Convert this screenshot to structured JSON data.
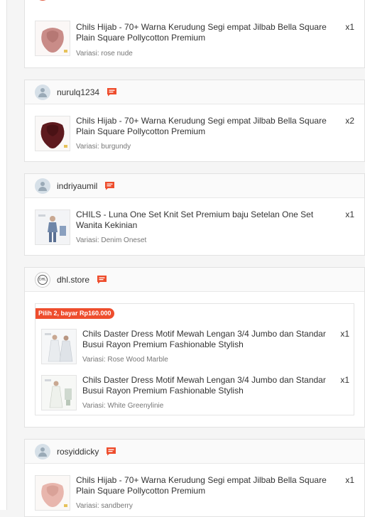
{
  "orders": [
    {
      "items": [
        {
          "name": "Chils Hijab - 70+ Warna Kerudung Segi empat Jilbab Bella Square Plain Square Pollycotton Premium",
          "variation": "Variasi: rose nude",
          "qty": "x1"
        }
      ]
    },
    {
      "username": "nurulq1234",
      "items": [
        {
          "name": "Chils Hijab - 70+ Warna Kerudung Segi empat Jilbab Bella Square Plain Square Pollycotton Premium",
          "variation": "Variasi: burgundy",
          "qty": "x2"
        }
      ]
    },
    {
      "username": "indriyaumil",
      "items": [
        {
          "name": "CHILS - Luna One Set Knit Set Premium baju Setelan One Set Wanita Kekinian",
          "variation": "Variasi: Denim Oneset",
          "qty": "x1"
        }
      ]
    },
    {
      "username": "dhl.store",
      "bundle_label": "Pilih 2, bayar Rp160.000",
      "items": [
        {
          "name": "Chils Daster Dress Motif Mewah Lengan 3/4 Jumbo dan Standar Busui Rayon Premium Fashionable Stylish",
          "variation": "Variasi: Rose Wood Marble",
          "qty": "x1"
        },
        {
          "name": "Chils Daster Dress Motif Mewah Lengan 3/4 Jumbo dan Standar Busui Rayon Premium Fashionable Stylish",
          "variation": "Variasi: White Greenylinie",
          "qty": "x1"
        }
      ]
    },
    {
      "username": "rosyiddicky",
      "items": [
        {
          "name": "Chils Hijab - 70+ Warna Kerudung Segi empat Jilbab Bella Square Plain Square Pollycotton Premium",
          "variation": "Variasi: sandberry",
          "qty": "x1"
        }
      ]
    }
  ],
  "colors": {
    "accent": "#ee4d2d",
    "hijab_rose_nude": "#c98c88",
    "hijab_burgundy": "#5e1a1e",
    "hijab_sandberry": "#e8b6ad"
  },
  "icons": {
    "chat": "chat-icon",
    "avatar": "user-avatar-icon"
  }
}
